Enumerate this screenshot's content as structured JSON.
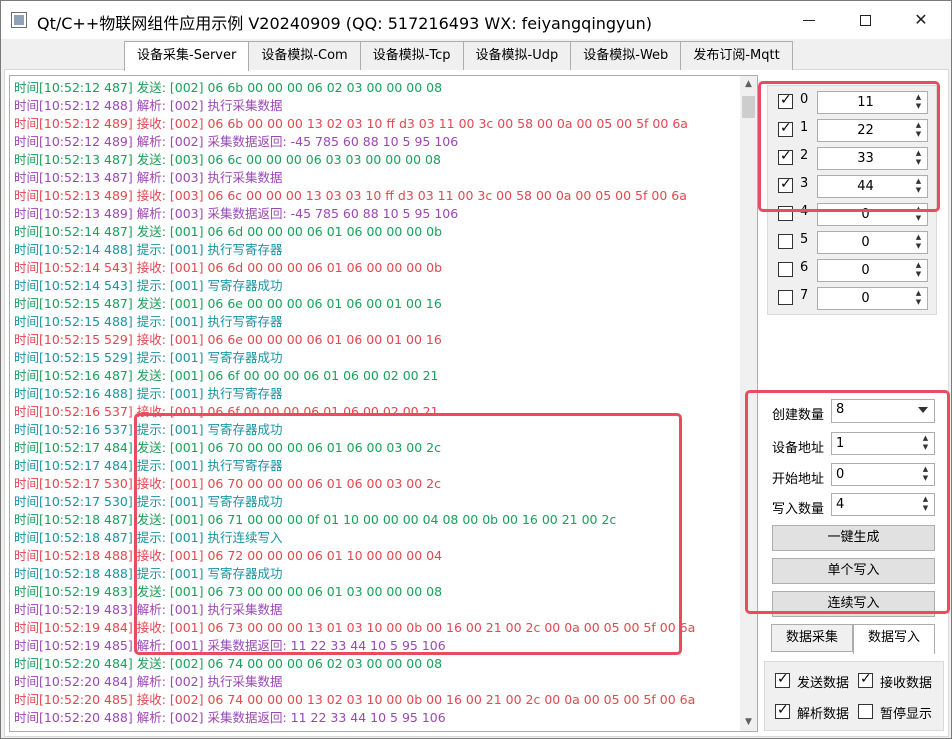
{
  "window": {
    "title": "Qt/C++物联网组件应用示例 V20240909 (QQ: 517216493 WX: feiyangqingyun)"
  },
  "tabs": [
    {
      "label": "设备采集-Server",
      "active": true
    },
    {
      "label": "设备模拟-Com"
    },
    {
      "label": "设备模拟-Tcp"
    },
    {
      "label": "设备模拟-Udp"
    },
    {
      "label": "设备模拟-Web"
    },
    {
      "label": "发布订阅-Mqtt"
    }
  ],
  "log": [
    {
      "type": "send",
      "text": "时间[10:52:12 487] 发送: [002] 06 6b 00 00 00 06 02 03 00 00 00 08"
    },
    {
      "type": "parse",
      "text": "时间[10:52:12 488] 解析: [002] 执行采集数据"
    },
    {
      "type": "recv",
      "text": "时间[10:52:12 489] 接收: [002] 06 6b 00 00 00 13 02 03 10 ff d3 03 11 00 3c 00 58 00 0a 00 05 00 5f 00 6a"
    },
    {
      "type": "parse",
      "text": "时间[10:52:12 489] 解析: [002] 采集数据返回: -45 785 60 88 10 5 95 106"
    },
    {
      "type": "send",
      "text": "时间[10:52:13 487] 发送: [003] 06 6c 00 00 00 06 03 03 00 00 00 08"
    },
    {
      "type": "parse",
      "text": "时间[10:52:13 487] 解析: [003] 执行采集数据"
    },
    {
      "type": "recv",
      "text": "时间[10:52:13 489] 接收: [003] 06 6c 00 00 00 13 03 03 10 ff d3 03 11 00 3c 00 58 00 0a 00 05 00 5f 00 6a"
    },
    {
      "type": "parse",
      "text": "时间[10:52:13 489] 解析: [003] 采集数据返回: -45 785 60 88 10 5 95 106"
    },
    {
      "type": "send",
      "text": "时间[10:52:14 487] 发送: [001] 06 6d 00 00 00 06 01 06 00 00 00 0b"
    },
    {
      "type": "hint",
      "text": "时间[10:52:14 488] 提示: [001] 执行写寄存器"
    },
    {
      "type": "recv",
      "text": "时间[10:52:14 543] 接收: [001] 06 6d 00 00 00 06 01 06 00 00 00 0b"
    },
    {
      "type": "hint",
      "text": "时间[10:52:14 543] 提示: [001] 写寄存器成功"
    },
    {
      "type": "send",
      "text": "时间[10:52:15 487] 发送: [001] 06 6e 00 00 00 06 01 06 00 01 00 16"
    },
    {
      "type": "hint",
      "text": "时间[10:52:15 488] 提示: [001] 执行写寄存器"
    },
    {
      "type": "recv",
      "text": "时间[10:52:15 529] 接收: [001] 06 6e 00 00 00 06 01 06 00 01 00 16"
    },
    {
      "type": "hint",
      "text": "时间[10:52:15 529] 提示: [001] 写寄存器成功"
    },
    {
      "type": "send",
      "text": "时间[10:52:16 487] 发送: [001] 06 6f 00 00 00 06 01 06 00 02 00 21"
    },
    {
      "type": "hint",
      "text": "时间[10:52:16 488] 提示: [001] 执行写寄存器"
    },
    {
      "type": "recv",
      "text": "时间[10:52:16 537] 接收: [001] 06 6f 00 00 00 06 01 06 00 02 00 21"
    },
    {
      "type": "hint",
      "text": "时间[10:52:16 537] 提示: [001] 写寄存器成功"
    },
    {
      "type": "send",
      "text": "时间[10:52:17 484] 发送: [001] 06 70 00 00 00 06 01 06 00 03 00 2c"
    },
    {
      "type": "hint",
      "text": "时间[10:52:17 484] 提示: [001] 执行写寄存器"
    },
    {
      "type": "recv",
      "text": "时间[10:52:17 530] 接收: [001] 06 70 00 00 00 06 01 06 00 03 00 2c"
    },
    {
      "type": "hint",
      "text": "时间[10:52:17 530] 提示: [001] 写寄存器成功"
    },
    {
      "type": "send",
      "text": "时间[10:52:18 487] 发送: [001] 06 71 00 00 00 0f 01 10 00 00 00 04 08 00 0b 00 16 00 21 00 2c"
    },
    {
      "type": "hint",
      "text": "时间[10:52:18 487] 提示: [001] 执行连续写入"
    },
    {
      "type": "recv",
      "text": "时间[10:52:18 488] 接收: [001] 06 72 00 00 00 06 01 10 00 00 00 04"
    },
    {
      "type": "hint",
      "text": "时间[10:52:18 488] 提示: [001] 写寄存器成功"
    },
    {
      "type": "send",
      "text": "时间[10:52:19 483] 发送: [001] 06 73 00 00 00 06 01 03 00 00 00 08"
    },
    {
      "type": "parse",
      "text": "时间[10:52:19 483] 解析: [001] 执行采集数据"
    },
    {
      "type": "recv",
      "text": "时间[10:52:19 484] 接收: [001] 06 73 00 00 00 13 01 03 10 00 0b 00 16 00 21 00 2c 00 0a 00 05 00 5f 00 6a"
    },
    {
      "type": "parse",
      "text": "时间[10:52:19 485] 解析: [001] 采集数据返回: 11 22 33 44 10 5 95 106"
    },
    {
      "type": "send",
      "text": "时间[10:52:20 484] 发送: [002] 06 74 00 00 00 06 02 03 00 00 00 08"
    },
    {
      "type": "parse",
      "text": "时间[10:52:20 484] 解析: [002] 执行采集数据"
    },
    {
      "type": "recv",
      "text": "时间[10:52:20 485] 接收: [002] 06 74 00 00 00 13 02 03 10 00 0b 00 16 00 21 00 2c 00 0a 00 05 00 5f 00 6a"
    },
    {
      "type": "parse",
      "text": "时间[10:52:20 488] 解析: [002] 采集数据返回: 11 22 33 44 10 5 95 106"
    }
  ],
  "registers": [
    {
      "label": "0",
      "checked": true,
      "value": "11"
    },
    {
      "label": "1",
      "checked": true,
      "value": "22"
    },
    {
      "label": "2",
      "checked": true,
      "value": "33"
    },
    {
      "label": "3",
      "checked": true,
      "value": "44"
    },
    {
      "label": "4",
      "checked": false,
      "value": "0"
    },
    {
      "label": "5",
      "checked": false,
      "value": "0"
    },
    {
      "label": "6",
      "checked": false,
      "value": "0"
    },
    {
      "label": "7",
      "checked": false,
      "value": "0"
    }
  ],
  "write": {
    "create_count_label": "创建数量",
    "create_count_value": "8",
    "device_addr_label": "设备地址",
    "device_addr_value": "1",
    "start_addr_label": "开始地址",
    "start_addr_value": "0",
    "write_count_label": "写入数量",
    "write_count_value": "4",
    "generate_button": "一键生成",
    "single_write_button": "单个写入",
    "continuous_write_button": "连续写入"
  },
  "subtabs": [
    {
      "label": "数据采集"
    },
    {
      "label": "数据写入",
      "active": true
    }
  ],
  "options": {
    "send_data": {
      "label": "发送数据",
      "checked": true
    },
    "recv_data": {
      "label": "接收数据",
      "checked": true
    },
    "parse_data": {
      "label": "解析数据",
      "checked": true
    },
    "pause_display": {
      "label": "暂停显示",
      "checked": false
    }
  },
  "colors": {
    "send": "#1aa05a",
    "parse": "#9b48b5",
    "recv": "#e3474f",
    "hint": "#1994a0",
    "highlight": "#ea4c5f"
  }
}
